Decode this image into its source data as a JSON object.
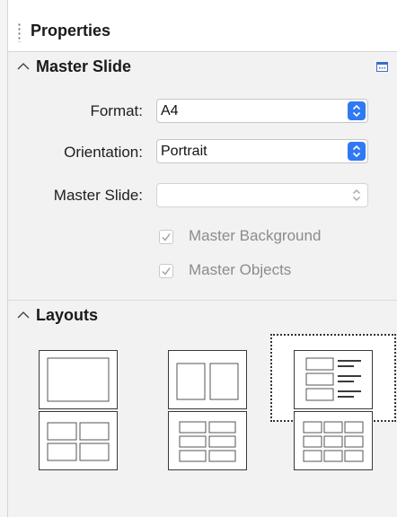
{
  "panel": {
    "title": "Properties"
  },
  "master_slide_section": {
    "title": "Master Slide",
    "format": {
      "label": "Format:",
      "value": "A4"
    },
    "orientation": {
      "label": "Orientation:",
      "value": "Portrait"
    },
    "master_slide": {
      "label": "Master Slide:",
      "value": ""
    },
    "master_background": {
      "label": "Master Background",
      "checked": true,
      "enabled": false
    },
    "master_objects": {
      "label": "Master Objects",
      "checked": true,
      "enabled": false
    }
  },
  "layouts_section": {
    "title": "Layouts",
    "selected_layout": "title-content",
    "layouts": [
      "blank",
      "two-columns",
      "title-content",
      "four-boxes",
      "six-boxes-two-columns",
      "nine-boxes"
    ]
  },
  "colors": {
    "accent": "#2f79f5",
    "panel_bg": "#f2f2f2"
  }
}
